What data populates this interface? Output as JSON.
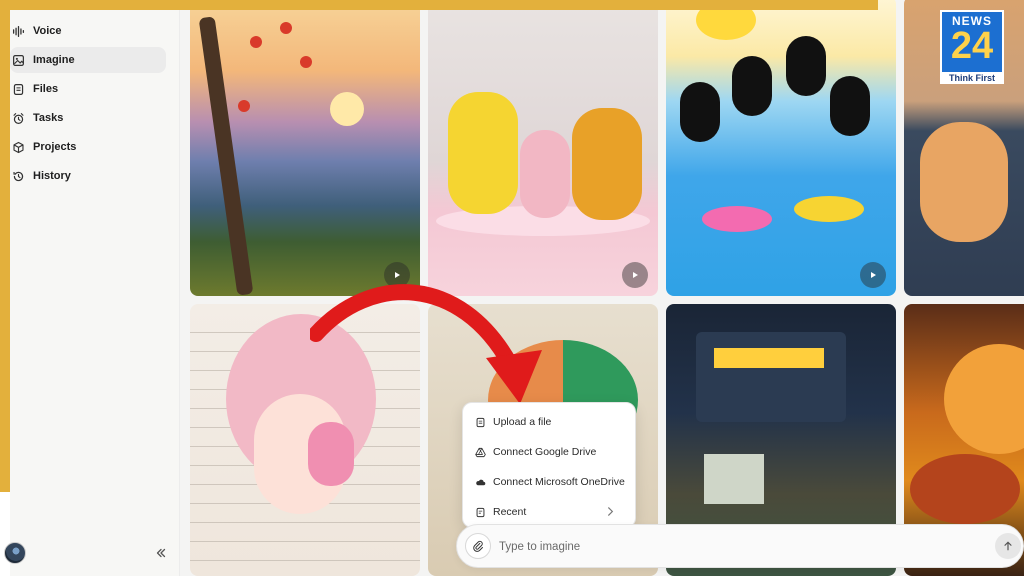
{
  "sidebar": {
    "items": [
      {
        "label": "Voice",
        "icon": "waveform-icon"
      },
      {
        "label": "Imagine",
        "icon": "image-icon",
        "active": true
      },
      {
        "label": "Files",
        "icon": "file-icon"
      },
      {
        "label": "Tasks",
        "icon": "alarm-clock-icon"
      },
      {
        "label": "Projects",
        "icon": "box-icon"
      },
      {
        "label": "History",
        "icon": "history-icon"
      }
    ]
  },
  "gallery": {
    "news_badge": {
      "word": "NEWS",
      "number": "24",
      "tagline": "Think First"
    }
  },
  "attach_menu": {
    "items": [
      {
        "label": "Upload a file",
        "icon": "file-icon"
      },
      {
        "label": "Connect Google Drive",
        "icon": "google-drive-icon"
      },
      {
        "label": "Connect Microsoft OneDrive",
        "icon": "cloud-icon"
      },
      {
        "label": "Recent",
        "icon": "recent-file-icon"
      }
    ]
  },
  "prompt": {
    "placeholder": "Type to imagine"
  },
  "colors": {
    "frame": "#e3b03c",
    "arrow": "#e01b1b",
    "news_blue": "#1c6fd1"
  }
}
